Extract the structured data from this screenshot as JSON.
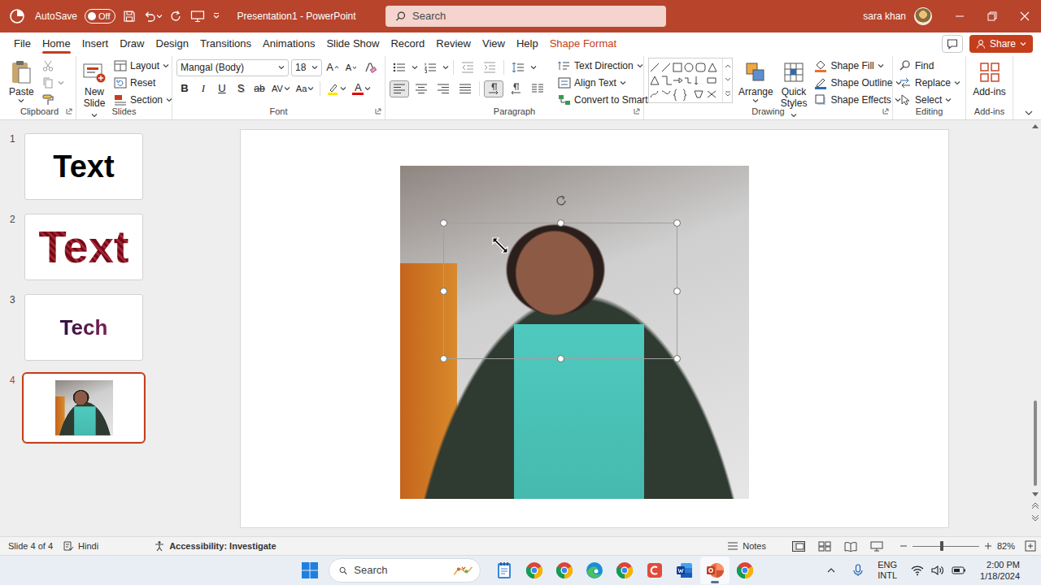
{
  "title_bar": {
    "autosave": "AutoSave",
    "autosave_state": "Off",
    "autosave_on": false,
    "document": "Presentation1 - PowerPoint",
    "search_placeholder": "Search",
    "user": "sara khan"
  },
  "ribbon_tabs": [
    {
      "label": "File",
      "selected": false,
      "kind": "standard"
    },
    {
      "label": "Home",
      "selected": true,
      "kind": "standard"
    },
    {
      "label": "Insert",
      "selected": false,
      "kind": "standard"
    },
    {
      "label": "Draw",
      "selected": false,
      "kind": "standard"
    },
    {
      "label": "Design",
      "selected": false,
      "kind": "standard"
    },
    {
      "label": "Transitions",
      "selected": false,
      "kind": "standard"
    },
    {
      "label": "Animations",
      "selected": false,
      "kind": "standard"
    },
    {
      "label": "Slide Show",
      "selected": false,
      "kind": "standard"
    },
    {
      "label": "Record",
      "selected": false,
      "kind": "standard"
    },
    {
      "label": "Review",
      "selected": false,
      "kind": "standard"
    },
    {
      "label": "View",
      "selected": false,
      "kind": "standard"
    },
    {
      "label": "Help",
      "selected": false,
      "kind": "standard"
    },
    {
      "label": "Shape Format",
      "selected": false,
      "kind": "contextual"
    }
  ],
  "share": "Share",
  "ribbon": {
    "clipboard": {
      "paste": "Paste",
      "label": "Clipboard"
    },
    "slides": {
      "new_slide": "New Slide",
      "layout": "Layout",
      "reset": "Reset",
      "section": "Section",
      "label": "Slides"
    },
    "font": {
      "name": "Mangal (Body)",
      "size": "18",
      "grow": "A",
      "shrink": "A",
      "bold": "B",
      "italic": "I",
      "underline": "U",
      "shadow": "S",
      "strike": "ab",
      "spacing": "AV",
      "case": "Aa",
      "color": "A",
      "label": "Font"
    },
    "paragraph": {
      "alignments": [
        {
          "kind": "left",
          "selected": true
        },
        {
          "kind": "center",
          "selected": false
        },
        {
          "kind": "right",
          "selected": false
        },
        {
          "kind": "justify",
          "selected": false
        }
      ],
      "directions": [
        {
          "kind": "ltr",
          "selected": true
        },
        {
          "kind": "rtl",
          "selected": false
        }
      ],
      "text_direction": "Text Direction",
      "align_text": "Align Text",
      "smartart": "Convert to SmartArt",
      "label": "Paragraph"
    },
    "drawing": {
      "arrange": "Arrange",
      "quick_styles": "Quick Styles",
      "shape_fill": "Shape Fill",
      "shape_outline": "Shape Outline",
      "shape_effects": "Shape Effects",
      "label": "Drawing"
    },
    "editing": {
      "find": "Find",
      "replace": "Replace",
      "select": "Select",
      "label": "Editing"
    },
    "addins": {
      "button": "Add-ins",
      "label": "Add-ins"
    }
  },
  "slides": [
    {
      "number": "1",
      "kind": "text",
      "text": "Text",
      "selected": false
    },
    {
      "number": "2",
      "kind": "texture",
      "text": "Text",
      "selected": false
    },
    {
      "number": "3",
      "kind": "small",
      "text": "Tech",
      "selected": false
    },
    {
      "number": "4",
      "kind": "photo",
      "selected": true
    }
  ],
  "status_bar": {
    "slide": "Slide 4 of 4",
    "language": "Hindi",
    "accessibility": "Accessibility: Investigate",
    "notes": "Notes",
    "zoom": "82%",
    "zoom_level": 0.44
  },
  "taskbar": {
    "search_placeholder": "Search",
    "apps": [
      {
        "kind": "notepad",
        "active": false
      },
      {
        "kind": "chrome",
        "active": false
      },
      {
        "kind": "chrome",
        "active": false
      },
      {
        "kind": "edge",
        "active": false
      },
      {
        "kind": "chrome",
        "active": false
      },
      {
        "kind": "app",
        "active": false
      },
      {
        "kind": "word",
        "active": false
      },
      {
        "kind": "powerpoint",
        "active": true
      },
      {
        "kind": "chrome",
        "active": false
      }
    ],
    "language": "ENG",
    "keyboard": "INTL",
    "time": "2:00 PM",
    "date": "1/18/2024"
  }
}
